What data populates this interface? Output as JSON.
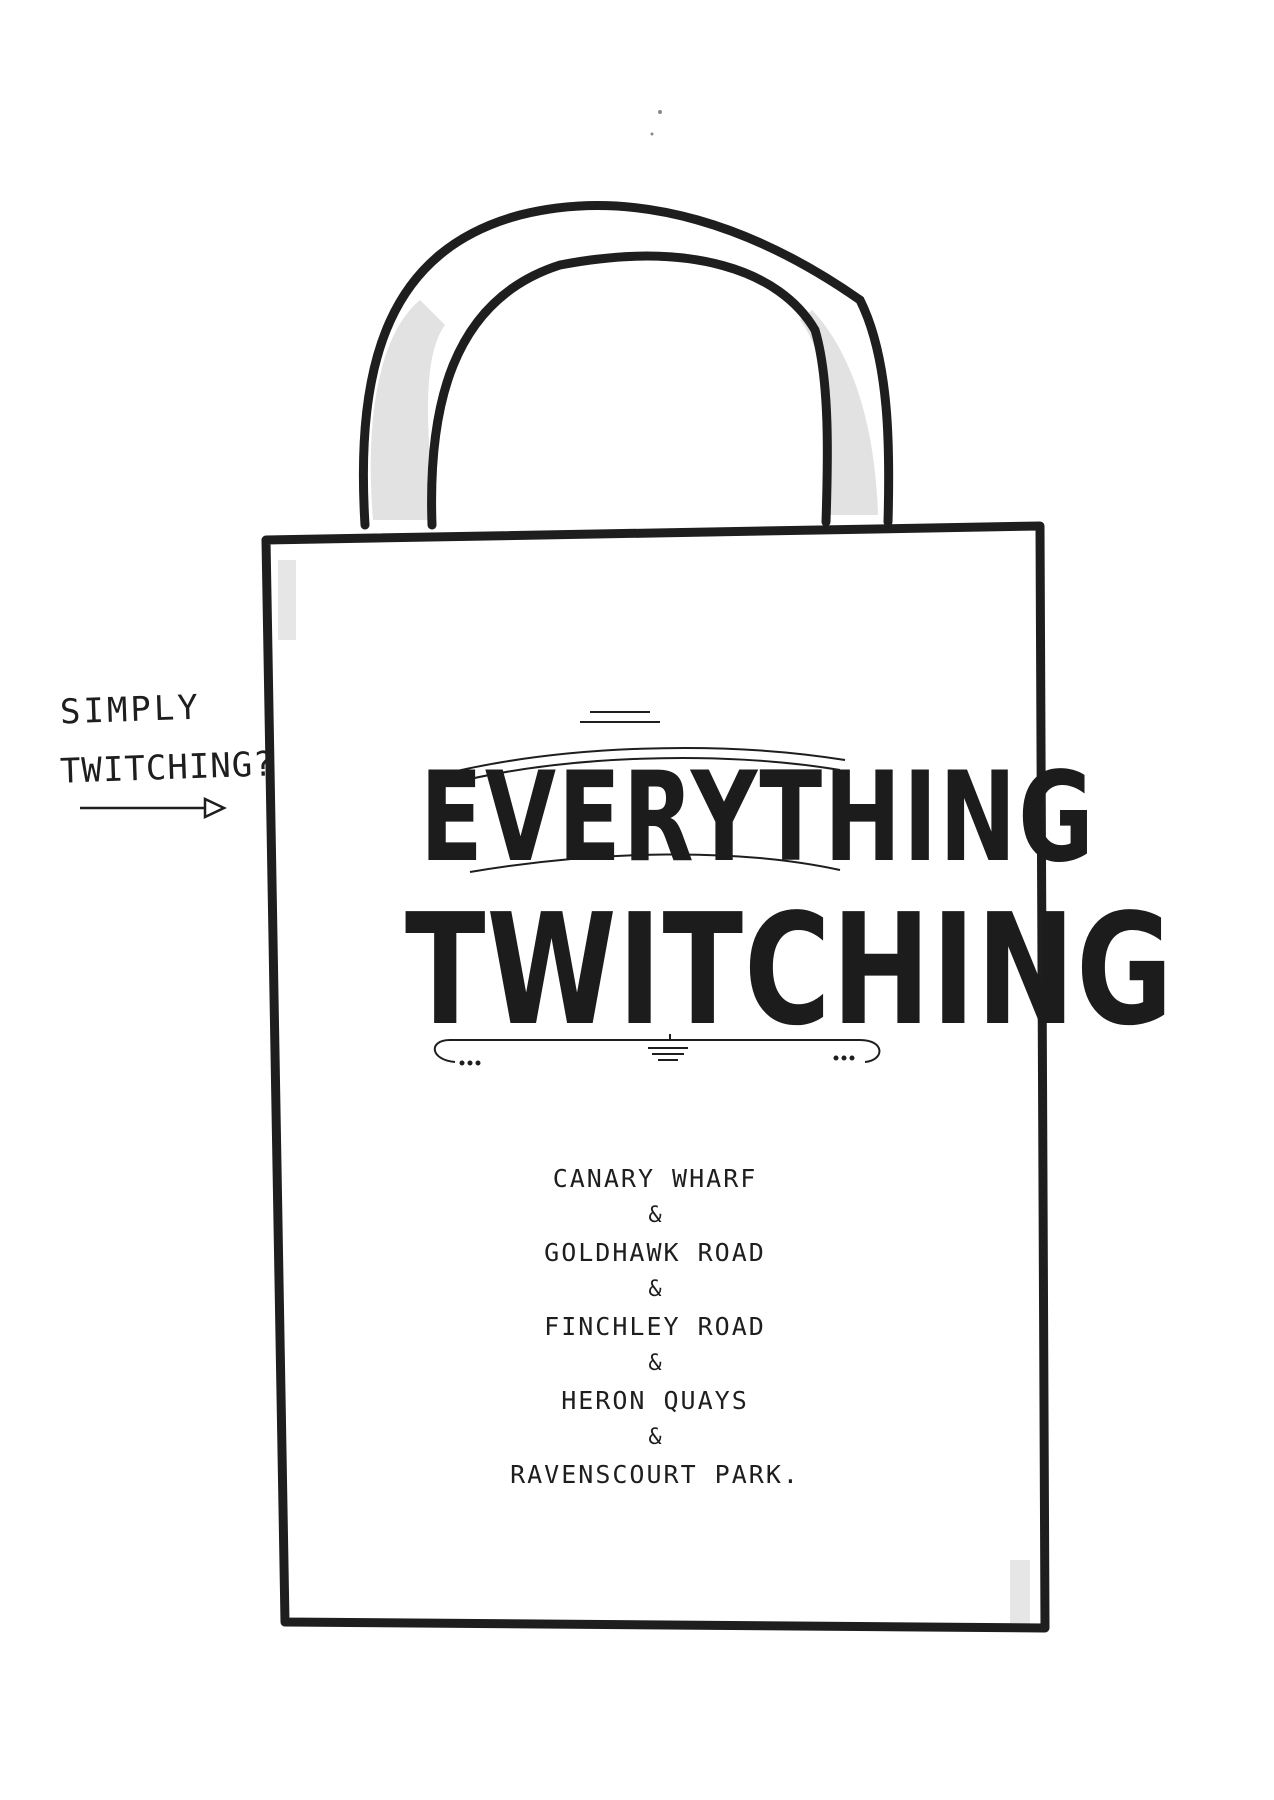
{
  "side_note": {
    "line1": "SIMPLY",
    "line2": "TWITCHING?"
  },
  "bag": {
    "title_line1": "EVERYTHING",
    "title_line2": "TWITCHING",
    "locations": [
      "CANARY WHARF",
      "GOLDHAWK ROAD",
      "FINCHLEY ROAD",
      "HERON QUAYS",
      "RAVENSCOURT PARK."
    ],
    "separator": "&"
  },
  "colors": {
    "ink": "#1e1e1e",
    "paper": "#ffffff",
    "shade": "#d9d9d9"
  },
  "icons": {
    "arrow": "arrow-right-icon",
    "bag": "tote-bag-icon"
  }
}
